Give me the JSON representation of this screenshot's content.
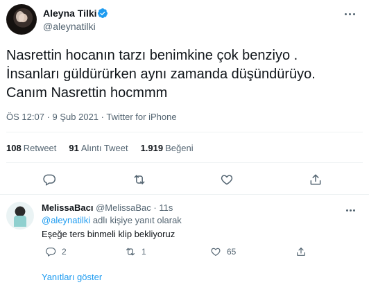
{
  "tweet": {
    "author_name": "Aleyna Tilki",
    "author_handle": "@aleynatilki",
    "text_lines": [
      "Nasrettin hocanın tarzı benimkine çok benziyo .",
      "İnsanları güldürürken aynı zamanda düşündürüyo.",
      "Canım Nasrettin hocmmm"
    ],
    "time": "ÖS 12:07",
    "separator": "·",
    "date": "9 Şub 2021",
    "source": "Twitter for iPhone",
    "stats": {
      "retweets_count": "108",
      "retweets_label": "Retweet",
      "quotes_count": "91",
      "quotes_label": "Alıntı Tweet",
      "likes_count": "1.919",
      "likes_label": "Beğeni"
    }
  },
  "reply": {
    "author_name": "MelissaBacı",
    "author_handle": "@MelissaBac",
    "separator": "·",
    "time_ago": "11s",
    "reply_to_mention": "@aleynatilki",
    "reply_to_suffix": "adlı kişiye yanıt olarak",
    "text": "Eşeğe ters binmeli klip bekliyoruz",
    "reply_count": "2",
    "retweet_count": "1",
    "like_count": "65"
  },
  "show_replies_label": "Yanıtları göster",
  "colors": {
    "accent": "#1d9bf0",
    "secondary_text": "#536471",
    "divider": "#eff3f4"
  },
  "icons": [
    "verified-icon",
    "more-icon",
    "reply-icon",
    "retweet-icon",
    "like-icon",
    "share-icon"
  ]
}
